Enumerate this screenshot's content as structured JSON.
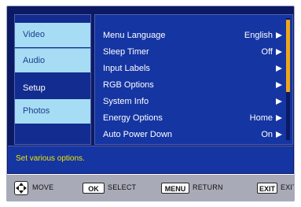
{
  "sidebar": {
    "items": [
      {
        "label": "Video"
      },
      {
        "label": "Audio"
      },
      {
        "label": "Setup"
      },
      {
        "label": "Photos"
      }
    ]
  },
  "menu": {
    "rows": [
      {
        "label": "Menu Language",
        "value": "English"
      },
      {
        "label": "Sleep Timer",
        "value": "Off"
      },
      {
        "label": "Input Labels",
        "value": ""
      },
      {
        "label": "RGB Options",
        "value": ""
      },
      {
        "label": "System Info",
        "value": ""
      },
      {
        "label": "Energy Options",
        "value": "Home"
      },
      {
        "label": "Auto Power Down",
        "value": "On"
      }
    ]
  },
  "help": {
    "text": "Set various options."
  },
  "footer": {
    "move_label": "MOVE",
    "ok_key": "OK",
    "select_label": "SELECT",
    "menu_key": "MENU",
    "return_label": "RETURN",
    "exit_key": "EXIT",
    "exit_label": "EXIT"
  },
  "colors": {
    "panel_bg": "#0c1a63",
    "list_bg": "#1535a2",
    "sidebar_highlight": "#a6ddf5",
    "help_text": "#f2e400",
    "scroll_thumb": "#f0a61a",
    "footer_bg": "#a8aab7"
  },
  "icons": {
    "row_arrow": "right-triangle-icon",
    "dpad": "dpad-icon"
  }
}
